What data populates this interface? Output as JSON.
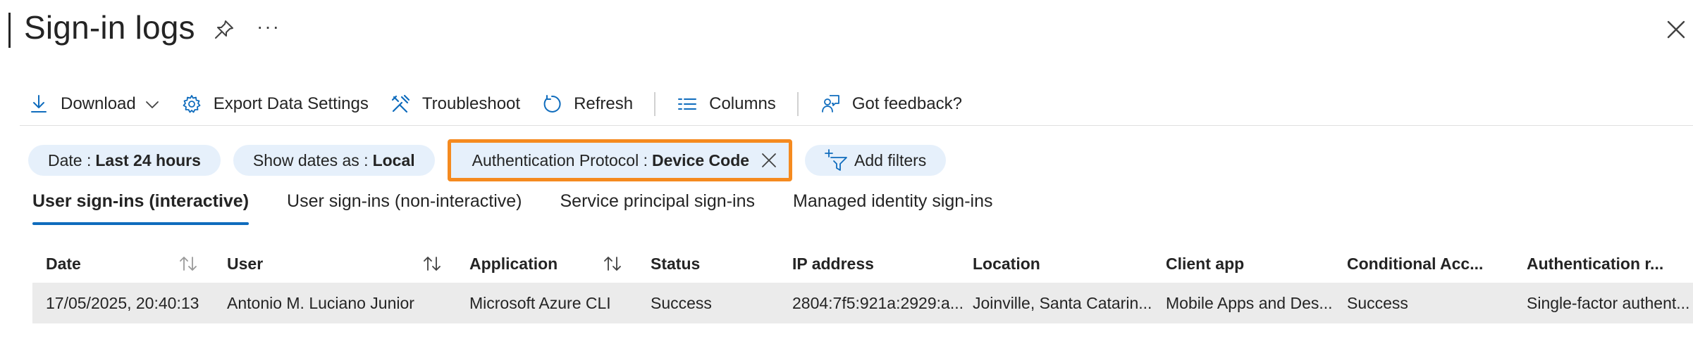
{
  "header": {
    "title": "Sign-in logs",
    "more_label": "···"
  },
  "toolbar": {
    "download": "Download",
    "export": "Export Data Settings",
    "troubleshoot": "Troubleshoot",
    "refresh": "Refresh",
    "columns": "Columns",
    "feedback": "Got feedback?"
  },
  "filters": {
    "date_prefix": "Date :",
    "date_value": "Last 24 hours",
    "showdates_prefix": "Show dates as :",
    "showdates_value": "Local",
    "auth_prefix": "Authentication Protocol :",
    "auth_value": "Device Code",
    "add_filters": "Add filters",
    "highlight_color": "#f58a1f"
  },
  "tabs": [
    {
      "label": "User sign-ins (interactive)",
      "active": true
    },
    {
      "label": "User sign-ins (non-interactive)",
      "active": false
    },
    {
      "label": "Service principal sign-ins",
      "active": false
    },
    {
      "label": "Managed identity sign-ins",
      "active": false
    }
  ],
  "table": {
    "columns": [
      "Date",
      "User",
      "Application",
      "Status",
      "IP address",
      "Location",
      "Client app",
      "Conditional Acc...",
      "Authentication r..."
    ],
    "rows": [
      [
        "17/05/2025, 20:40:13",
        "Antonio M. Luciano Junior",
        "Microsoft Azure CLI",
        "Success",
        "2804:7f5:921a:2929:a...",
        "Joinville, Santa Catarin...",
        "Mobile Apps and Des...",
        "Success",
        "Single-factor authent..."
      ]
    ]
  },
  "colors": {
    "accent": "#0f6cbd",
    "pill_bg": "#e6f0fb",
    "row_bg": "#ebebeb"
  }
}
